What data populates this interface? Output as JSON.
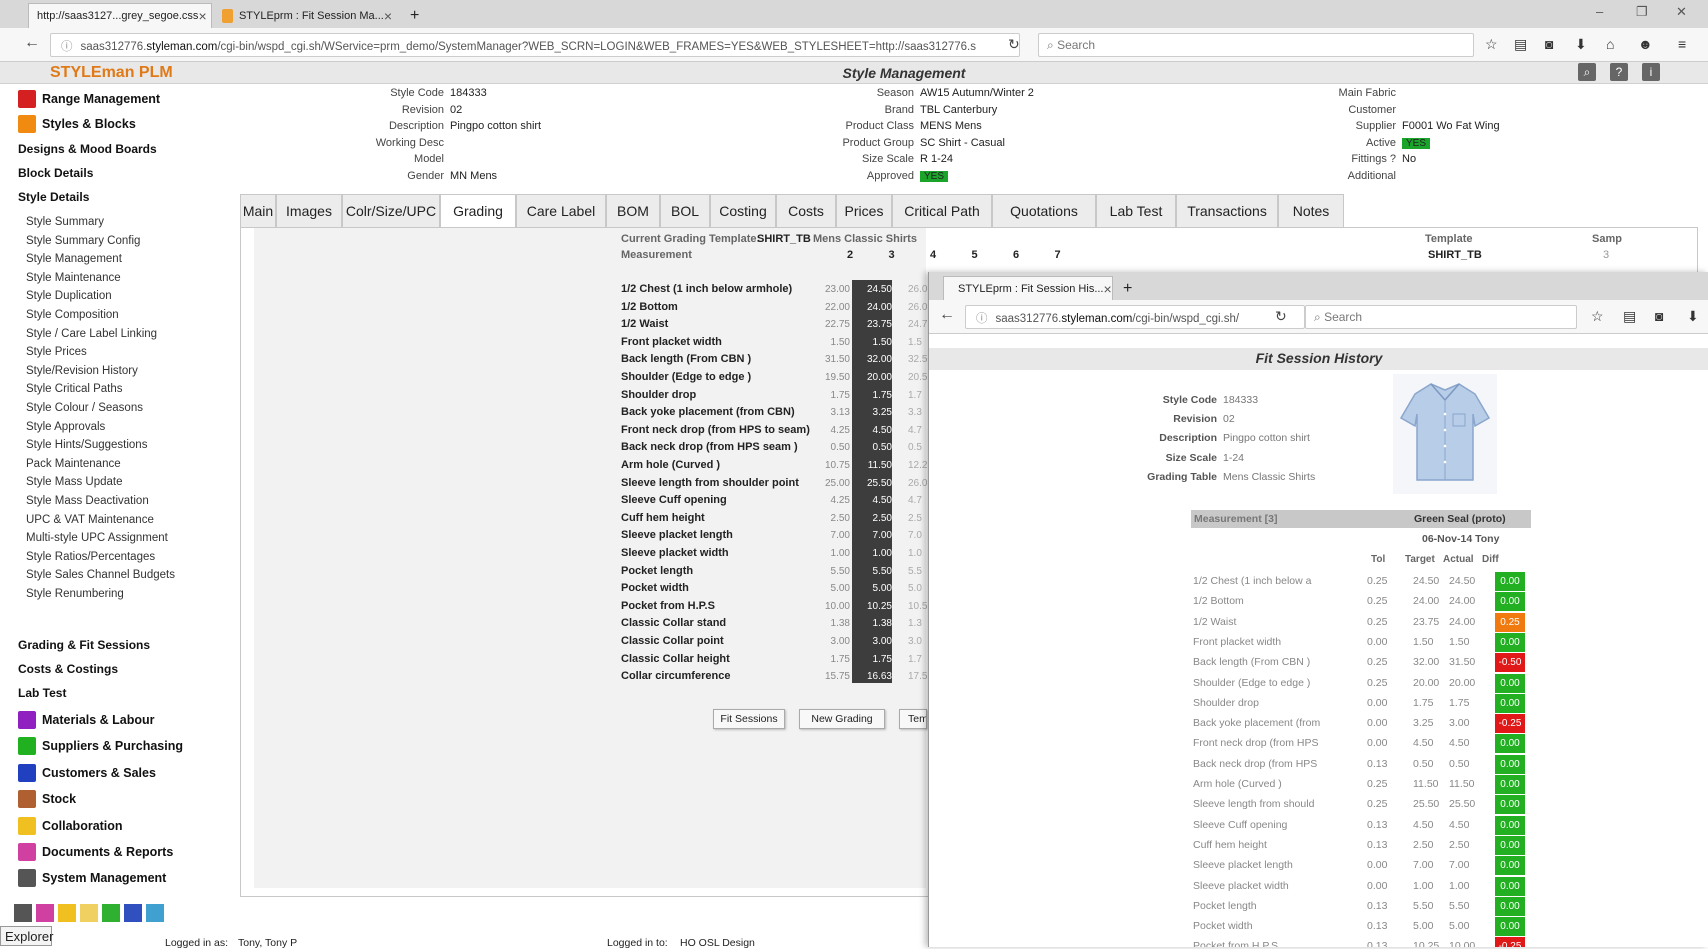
{
  "browser": {
    "tabs": [
      {
        "title": "http://saas3127...grey_segoe.css",
        "active": true
      },
      {
        "title": "STYLEprm : Fit Session Ma...",
        "active": false
      }
    ],
    "url_prefix": "saas312776.",
    "url_domain": "styleman.com",
    "url_rest": "/cgi-bin/wspd_cgi.sh/WService=prm_demo/SystemManager?WEB_SCRN=LOGIN&WEB_FRAMES=YES&WEB_STYLESHEET=http://saas312776.s",
    "search_placeholder": "Search",
    "new_tab": "+"
  },
  "app": {
    "logo": "STYLEman PLM",
    "page_title": "Style Management"
  },
  "sidebar": {
    "top_sections": [
      {
        "label": "Range Management",
        "icon": "range-icon",
        "color": "#d42020"
      },
      {
        "label": "Styles & Blocks",
        "icon": "styles-icon",
        "color": "#f08a10"
      }
    ],
    "subheads_a": [
      "Designs & Mood Boards",
      "Block Details",
      "Style Details"
    ],
    "items": [
      "Style Summary",
      "Style Summary Config",
      "Style Management",
      "Style Maintenance",
      "Style Duplication",
      "Style Composition",
      "Style / Care Label Linking",
      "Style Prices",
      "Style/Revision History",
      "Style Critical Paths",
      "Style Colour / Seasons",
      "Style Approvals",
      "Style Hints/Suggestions",
      "Pack Maintenance",
      "Style Mass Update",
      "Style Mass Deactivation",
      "UPC & VAT Maintenance",
      "Multi-style UPC Assignment",
      "Style Ratios/Percentages",
      "Style Sales Channel Budgets",
      "Style Renumbering"
    ],
    "subheads_b": [
      "Grading & Fit Sessions",
      "Costs & Costings",
      "Lab Test"
    ],
    "bottom_sections": [
      {
        "label": "Materials & Labour",
        "icon": "materials-icon",
        "color": "#9020c0"
      },
      {
        "label": "Suppliers & Purchasing",
        "icon": "suppliers-icon",
        "color": "#20b020"
      },
      {
        "label": "Customers & Sales",
        "icon": "customers-icon",
        "color": "#2040c0"
      },
      {
        "label": "Stock",
        "icon": "stock-icon",
        "color": "#b06030"
      },
      {
        "label": "Collaboration",
        "icon": "collaboration-icon",
        "color": "#f0c020"
      },
      {
        "label": "Documents & Reports",
        "icon": "documents-icon",
        "color": "#d040a0"
      },
      {
        "label": "System Management",
        "icon": "system-icon",
        "color": "#555555"
      }
    ],
    "explorer_label": "Explorer"
  },
  "style_info": {
    "col1": [
      [
        "Style Code",
        "184333"
      ],
      [
        "Revision",
        "02"
      ],
      [
        "Description",
        "Pingpo cotton shirt"
      ],
      [
        "Working Desc",
        ""
      ],
      [
        "Model",
        ""
      ],
      [
        "Gender",
        "MN Mens"
      ]
    ],
    "col2": [
      [
        "Season",
        "AW15 Autumn/Winter 2"
      ],
      [
        "Brand",
        "TBL Canterbury"
      ],
      [
        "Product Class",
        "MENS Mens"
      ],
      [
        "Product Group",
        "SC Shirt - Casual"
      ],
      [
        "Size Scale",
        "R 1-24"
      ],
      [
        "Approved",
        "YES"
      ]
    ],
    "col3": [
      [
        "Main Fabric",
        ""
      ],
      [
        "Customer",
        ""
      ],
      [
        "Supplier",
        "F0001 Wo Fat Wing"
      ],
      [
        "Active",
        "YES"
      ],
      [
        "Fittings ?",
        "No"
      ],
      [
        "Additional",
        ""
      ]
    ]
  },
  "tabs": [
    "Main",
    "Images",
    "Colr/Size/UPC",
    "Grading",
    "Care Label",
    "BOM",
    "BOL",
    "Costing",
    "Costs",
    "Prices",
    "Critical Path",
    "Quotations",
    "Lab Test",
    "Transactions",
    "Notes"
  ],
  "active_tab": "Grading",
  "grading": {
    "template_label": "Current Grading Template:",
    "template_code": "SHIRT_TB",
    "template_name": "Mens Classic Shirts",
    "measurement_label": "Measurement",
    "sizes": [
      "2",
      "3",
      "4",
      "5",
      "6",
      "7"
    ],
    "right_template_label": "Template",
    "right_samp_label": "Samp",
    "right_template_value": "SHIRT_TB",
    "right_samp_value": "3",
    "rows": [
      {
        "name": "1/2 Chest (1 inch below armhole)",
        "s2": "23.00",
        "s3": "24.50",
        "s4": "26.0"
      },
      {
        "name": "1/2 Bottom",
        "s2": "22.00",
        "s3": "24.00",
        "s4": "26.0"
      },
      {
        "name": "1/2 Waist",
        "s2": "22.75",
        "s3": "23.75",
        "s4": "24.7"
      },
      {
        "name": "Front placket width",
        "s2": "1.50",
        "s3": "1.50",
        "s4": "1.5"
      },
      {
        "name": "Back length (From CBN )",
        "s2": "31.50",
        "s3": "32.00",
        "s4": "32.5"
      },
      {
        "name": "Shoulder (Edge to edge )",
        "s2": "19.50",
        "s3": "20.00",
        "s4": "20.5"
      },
      {
        "name": "Shoulder drop",
        "s2": "1.75",
        "s3": "1.75",
        "s4": "1.7"
      },
      {
        "name": "Back yoke placement (from CBN)",
        "s2": "3.13",
        "s3": "3.25",
        "s4": "3.3"
      },
      {
        "name": "Front neck drop (from HPS to seam)",
        "s2": "4.25",
        "s3": "4.50",
        "s4": "4.7"
      },
      {
        "name": "Back neck drop (from HPS seam )",
        "s2": "0.50",
        "s3": "0.50",
        "s4": "0.5"
      },
      {
        "name": "Arm hole (Curved )",
        "s2": "10.75",
        "s3": "11.50",
        "s4": "12.2"
      },
      {
        "name": "Sleeve length from shoulder point",
        "s2": "25.00",
        "s3": "25.50",
        "s4": "26.0"
      },
      {
        "name": "Sleeve Cuff opening",
        "s2": "4.25",
        "s3": "4.50",
        "s4": "4.7"
      },
      {
        "name": "Cuff hem height",
        "s2": "2.50",
        "s3": "2.50",
        "s4": "2.5"
      },
      {
        "name": "Sleeve placket length",
        "s2": "7.00",
        "s3": "7.00",
        "s4": "7.0"
      },
      {
        "name": "Sleeve placket width",
        "s2": "1.00",
        "s3": "1.00",
        "s4": "1.0"
      },
      {
        "name": "Pocket length",
        "s2": "5.50",
        "s3": "5.50",
        "s4": "5.5"
      },
      {
        "name": "Pocket width",
        "s2": "5.00",
        "s3": "5.00",
        "s4": "5.0"
      },
      {
        "name": "Pocket from H.P.S",
        "s2": "10.00",
        "s3": "10.25",
        "s4": "10.5"
      },
      {
        "name": "Classic Collar stand",
        "s2": "1.38",
        "s3": "1.38",
        "s4": "1.3"
      },
      {
        "name": "Classic Collar point",
        "s2": "3.00",
        "s3": "3.00",
        "s4": "3.0"
      },
      {
        "name": "Classic Collar height",
        "s2": "1.75",
        "s3": "1.75",
        "s4": "1.7"
      },
      {
        "name": "Collar circumference",
        "s2": "15.75",
        "s3": "16.63",
        "s4": "17.5"
      }
    ],
    "buttons": [
      "Fit Sessions",
      "New Grading",
      "Tem"
    ]
  },
  "status": {
    "logged_in_as_label": "Logged in as:",
    "logged_in_as": "Tony, Tony P",
    "logged_in_to_label": "Logged in to:",
    "logged_in_to": "HO OSL Design"
  },
  "popup": {
    "tab_title": "STYLEprm : Fit Session His...",
    "url_prefix": "saas312776.",
    "url_domain": "styleman.com",
    "url_rest": "/cgi-bin/wspd_cgi.sh/",
    "search_placeholder": "Search",
    "title": "Fit Session History",
    "info": [
      [
        "Style Code",
        "184333"
      ],
      [
        "Revision",
        "02"
      ],
      [
        "Description",
        "Pingpo cotton shirt"
      ],
      [
        "Size Scale",
        "1-24"
      ],
      [
        "Grading Table",
        "Mens Classic Shirts"
      ]
    ],
    "measurement_header": "Measurement [3]",
    "session_name": "Green Seal (proto)",
    "session_date": "06-Nov-14 Tony",
    "col_headers": [
      "Tol",
      "Target",
      "Actual",
      "Diff"
    ],
    "colors": {
      "ok": "#22b022",
      "warn": "#f07a10",
      "bad": "#e01818"
    },
    "rows": [
      {
        "name": "1/2 Chest (1 inch below a",
        "tol": "0.25",
        "target": "24.50",
        "actual": "24.50",
        "diff": "0.00",
        "status": "ok"
      },
      {
        "name": "1/2 Bottom",
        "tol": "0.25",
        "target": "24.00",
        "actual": "24.00",
        "diff": "0.00",
        "status": "ok"
      },
      {
        "name": "1/2 Waist",
        "tol": "0.25",
        "target": "23.75",
        "actual": "24.00",
        "diff": "0.25",
        "status": "warn"
      },
      {
        "name": "Front placket width",
        "tol": "0.00",
        "target": "1.50",
        "actual": "1.50",
        "diff": "0.00",
        "status": "ok"
      },
      {
        "name": "Back length (From CBN )",
        "tol": "0.25",
        "target": "32.00",
        "actual": "31.50",
        "diff": "-0.50",
        "status": "bad"
      },
      {
        "name": "Shoulder (Edge to edge )",
        "tol": "0.25",
        "target": "20.00",
        "actual": "20.00",
        "diff": "0.00",
        "status": "ok"
      },
      {
        "name": "Shoulder drop",
        "tol": "0.00",
        "target": "1.75",
        "actual": "1.75",
        "diff": "0.00",
        "status": "ok"
      },
      {
        "name": "Back yoke placement (from",
        "tol": "0.00",
        "target": "3.25",
        "actual": "3.00",
        "diff": "-0.25",
        "status": "bad"
      },
      {
        "name": "Front neck drop (from HPS",
        "tol": "0.00",
        "target": "4.50",
        "actual": "4.50",
        "diff": "0.00",
        "status": "ok"
      },
      {
        "name": "Back neck drop (from HPS",
        "tol": "0.13",
        "target": "0.50",
        "actual": "0.50",
        "diff": "0.00",
        "status": "ok"
      },
      {
        "name": "Arm hole (Curved )",
        "tol": "0.25",
        "target": "11.50",
        "actual": "11.50",
        "diff": "0.00",
        "status": "ok"
      },
      {
        "name": "Sleeve length from should",
        "tol": "0.25",
        "target": "25.50",
        "actual": "25.50",
        "diff": "0.00",
        "status": "ok"
      },
      {
        "name": "Sleeve Cuff opening",
        "tol": "0.13",
        "target": "4.50",
        "actual": "4.50",
        "diff": "0.00",
        "status": "ok"
      },
      {
        "name": "Cuff hem height",
        "tol": "0.13",
        "target": "2.50",
        "actual": "2.50",
        "diff": "0.00",
        "status": "ok"
      },
      {
        "name": "Sleeve placket length",
        "tol": "0.00",
        "target": "7.00",
        "actual": "7.00",
        "diff": "0.00",
        "status": "ok"
      },
      {
        "name": "Sleeve placket width",
        "tol": "0.00",
        "target": "1.00",
        "actual": "1.00",
        "diff": "0.00",
        "status": "ok"
      },
      {
        "name": "Pocket length",
        "tol": "0.13",
        "target": "5.50",
        "actual": "5.50",
        "diff": "0.00",
        "status": "ok"
      },
      {
        "name": "Pocket width",
        "tol": "0.13",
        "target": "5.00",
        "actual": "5.00",
        "diff": "0.00",
        "status": "ok"
      },
      {
        "name": "Pocket from H.P.S",
        "tol": "0.13",
        "target": "10.25",
        "actual": "10.00",
        "diff": "-0.25",
        "status": "bad"
      }
    ]
  }
}
